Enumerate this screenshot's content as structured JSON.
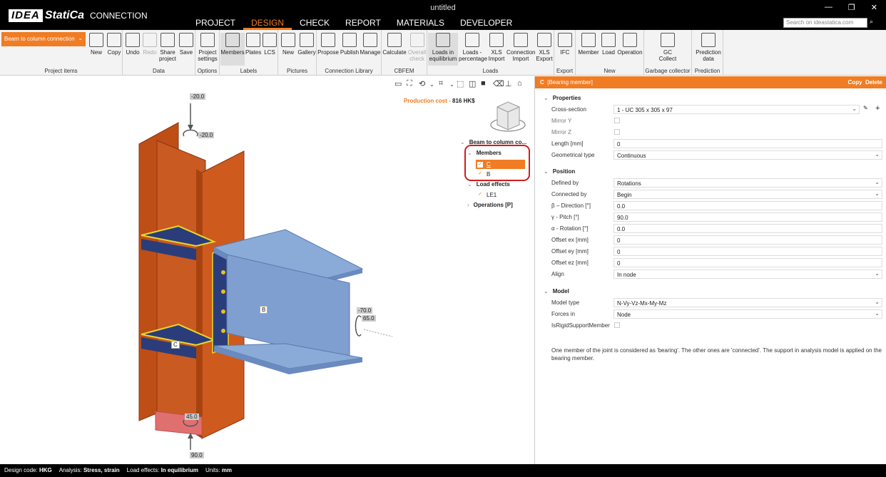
{
  "app": {
    "logo_brand": "IDEA",
    "logo_product": "StatiCa",
    "logo_module": "CONNECTION",
    "window_title": "untitled"
  },
  "menu": [
    "PROJECT",
    "DESIGN",
    "CHECK",
    "REPORT",
    "MATERIALS",
    "DEVELOPER"
  ],
  "search_placeholder": "Search on ideastatica.com",
  "ribbon": {
    "project_dropdown": "Beam to column connection",
    "groups": {
      "project_items": "Project items",
      "data": "Data",
      "options": "Options",
      "labels": "Labels",
      "pictures": "Pictures",
      "connection_library": "Connection Library",
      "cbfem": "CBFEM",
      "loads": "Loads",
      "export": "Export",
      "new": "New",
      "garbage": "Garbage collector",
      "prediction": "Prediction"
    },
    "buttons": {
      "new": "New",
      "copy": "Copy",
      "undo": "Undo",
      "redo": "Redo",
      "share": "Share project",
      "save": "Save",
      "project_settings": "Project settings",
      "members": "Members",
      "plates": "Plates",
      "lcs": "LCS",
      "pic_new": "New",
      "gallery": "Gallery",
      "propose": "Propose",
      "publish": "Publish",
      "manage": "Manage",
      "calculate": "Calculate",
      "overall_check": "Overall check",
      "loads_eq": "Loads in equilibrium",
      "loads_pct": "Loads - percentage",
      "xls_import": "XLS Import",
      "conn_import": "Connection Import",
      "xls_export": "XLS Export",
      "ifc": "IFC",
      "member": "Member",
      "load": "Load",
      "operation": "Operation",
      "gc_collect": "GC Collect",
      "prediction_data": "Prediction data"
    }
  },
  "viewport": {
    "production_cost_label": "Production cost -",
    "production_cost_value": "816 HK$",
    "labels": {
      "top_force": "-20.0",
      "top_moment": "-20.0",
      "beam_force": "-70.0",
      "beam_moment": "65.0",
      "bottom_moment": "45.0",
      "bottom_force": "90.0",
      "member_b": "B",
      "member_c": "C"
    },
    "tree": {
      "root": "Beam to column co...",
      "members": "Members",
      "member_c": "C",
      "member_b": "B",
      "load_effects": "Load effects",
      "le1": "LE1",
      "operations": "Operations [P]"
    }
  },
  "panel": {
    "header_name": "C",
    "header_role": "[Bearing member]",
    "copy": "Copy",
    "delete": "Delete",
    "properties": {
      "title": "Properties",
      "cross_section_label": "Cross-section",
      "cross_section": "1 - UC 305 x 305 x 97",
      "mirror_y": "Mirror Y",
      "mirror_z": "Mirror Z",
      "length_label": "Length [mm]",
      "length": "0",
      "geom_label": "Geometrical type",
      "geom": "Continuous"
    },
    "position": {
      "title": "Position",
      "defined_by_label": "Defined by",
      "defined_by": "Rotations",
      "connected_by_label": "Connected by",
      "connected_by": "Begin",
      "beta_label": "β – Direction [°]",
      "beta": "0.0",
      "gamma_label": "γ - Pitch [°]",
      "gamma": "90.0",
      "alpha_label": "α - Rotation [°]",
      "alpha": "0.0",
      "ex_label": "Offset ex [mm]",
      "ex": "0",
      "ey_label": "Offset ey [mm]",
      "ey": "0",
      "ez_label": "Offset ez [mm]",
      "ez": "0",
      "align_label": "Align",
      "align": "In node"
    },
    "model": {
      "title": "Model",
      "type_label": "Model type",
      "type": "N-Vy-Vz-Mx-My-Mz",
      "forces_label": "Forces in",
      "forces": "Node",
      "rigid_label": "IsRigidSupportMember"
    },
    "note": "One member of the joint is considered as 'bearing'. The other ones are 'connected'. The support in analysis model is applied on the bearing member."
  },
  "status": {
    "design_code_label": "Design code:",
    "design_code": "HKG",
    "analysis_label": "Analysis:",
    "analysis": "Stress, strain",
    "load_effects_label": "Load effects:",
    "load_effects": "In equilibrium",
    "units_label": "Units:",
    "units": "mm"
  },
  "colors": {
    "accent": "#f07c24",
    "column": "#c8501a",
    "beam": "#7f9fd0",
    "highlight": "#d41c1c"
  }
}
